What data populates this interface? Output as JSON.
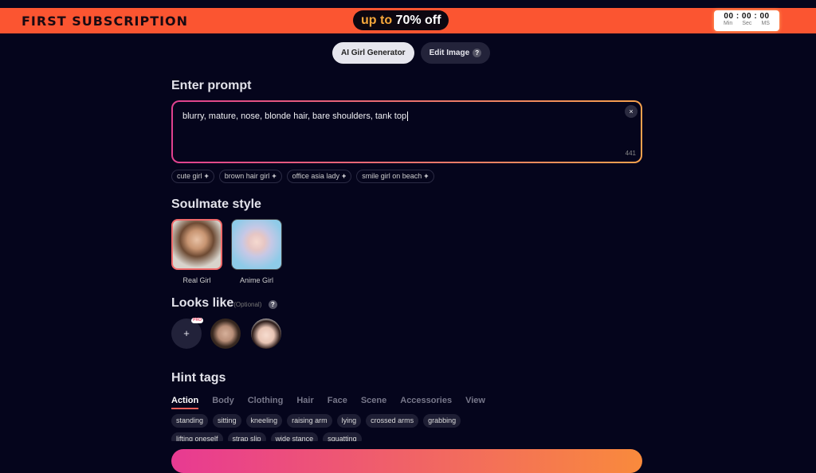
{
  "banner": {
    "title": "FIRST SUBSCRIPTION",
    "promo_a": "up to",
    "promo_b": "70% off",
    "timer": "00 : 00 : 00",
    "timer_labels": [
      "Min",
      "Sec",
      "MS"
    ]
  },
  "modes": [
    {
      "label": "AI Girl Generator"
    },
    {
      "label": "Edit Image"
    }
  ],
  "prompt": {
    "heading": "Enter prompt",
    "value": "blurry, mature, nose, blonde hair, bare shoulders, tank top",
    "count": "441",
    "clear": "×"
  },
  "suggestions": [
    "cute girl",
    "brown hair girl",
    "office asia lady",
    "smile girl on beach"
  ],
  "style": {
    "heading": "Soulmate style",
    "options": [
      {
        "label": "Real Girl",
        "selected": true
      },
      {
        "label": "Anime Girl"
      }
    ]
  },
  "looks": {
    "heading": "Looks like",
    "optional": "(Optional)",
    "pro": "PRO"
  },
  "hints": {
    "heading": "Hint tags",
    "tabs": [
      "Action",
      "Body",
      "Clothing",
      "Hair",
      "Face",
      "Scene",
      "Accessories",
      "View"
    ],
    "row1": [
      "standing",
      "sitting",
      "kneeling",
      "raising arm",
      "lying",
      "crossed arms",
      "grabbing"
    ],
    "row2": [
      "lifting oneself",
      "strap slip",
      "wide stance",
      "squatting"
    ]
  }
}
